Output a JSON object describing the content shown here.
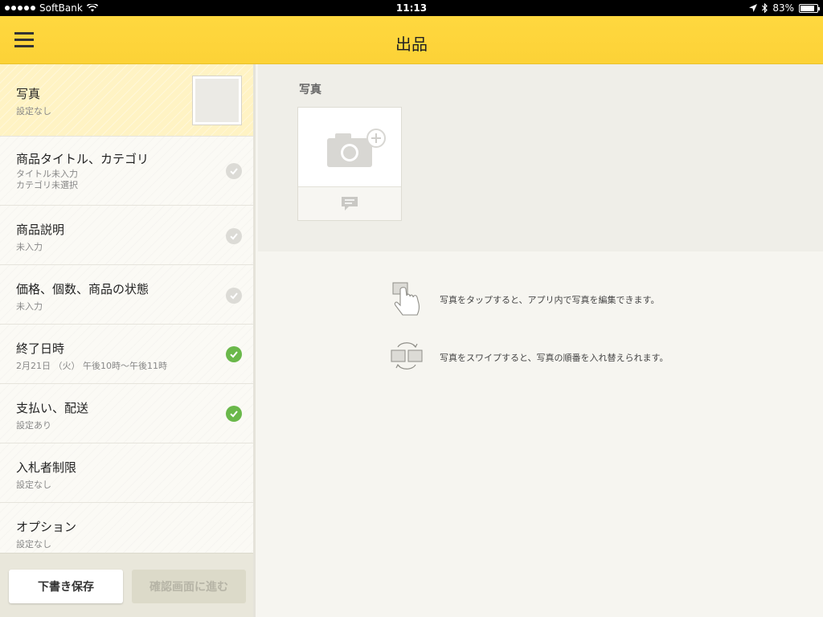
{
  "status_bar": {
    "carrier": "SoftBank",
    "time": "11:13",
    "battery": "83%",
    "battery_level": 0.83
  },
  "header": {
    "title": "出品",
    "menu_icon": "hamburger-icon"
  },
  "sidebar": {
    "items": [
      {
        "title": "写真",
        "sub": "設定なし"
      },
      {
        "title": "商品タイトル、カテゴリ",
        "sub1": "タイトル未入力",
        "sub2": "カテゴリ未選択",
        "status": "incomplete"
      },
      {
        "title": "商品説明",
        "sub": "未入力",
        "status": "incomplete"
      },
      {
        "title": "価格、個数、商品の状態",
        "sub": "未入力",
        "status": "incomplete"
      },
      {
        "title": "終了日時",
        "sub": "2月21日 （火） 午後10時〜午後11時",
        "status": "complete"
      },
      {
        "title": "支払い、配送",
        "sub": "設定あり",
        "status": "complete"
      },
      {
        "title": "入札者制限",
        "sub": "設定なし"
      },
      {
        "title": "オプション",
        "sub": "設定なし"
      }
    ],
    "buttons": {
      "draft": "下書き保存",
      "confirm": "確認画面に進む"
    }
  },
  "main": {
    "photo_label": "写真",
    "hints": [
      {
        "icon": "tap-hand-icon",
        "text": "写真をタップすると、アプリ内で写真を編集できます。"
      },
      {
        "icon": "swipe-swap-icon",
        "text": "写真をスワイプすると、写真の順番を入れ替えられます。"
      }
    ]
  },
  "colors": {
    "header_yellow": "#fcd237",
    "active_item": "#fff3c4",
    "check_green": "#6ab84a",
    "check_gray": "#dcdbd6"
  }
}
